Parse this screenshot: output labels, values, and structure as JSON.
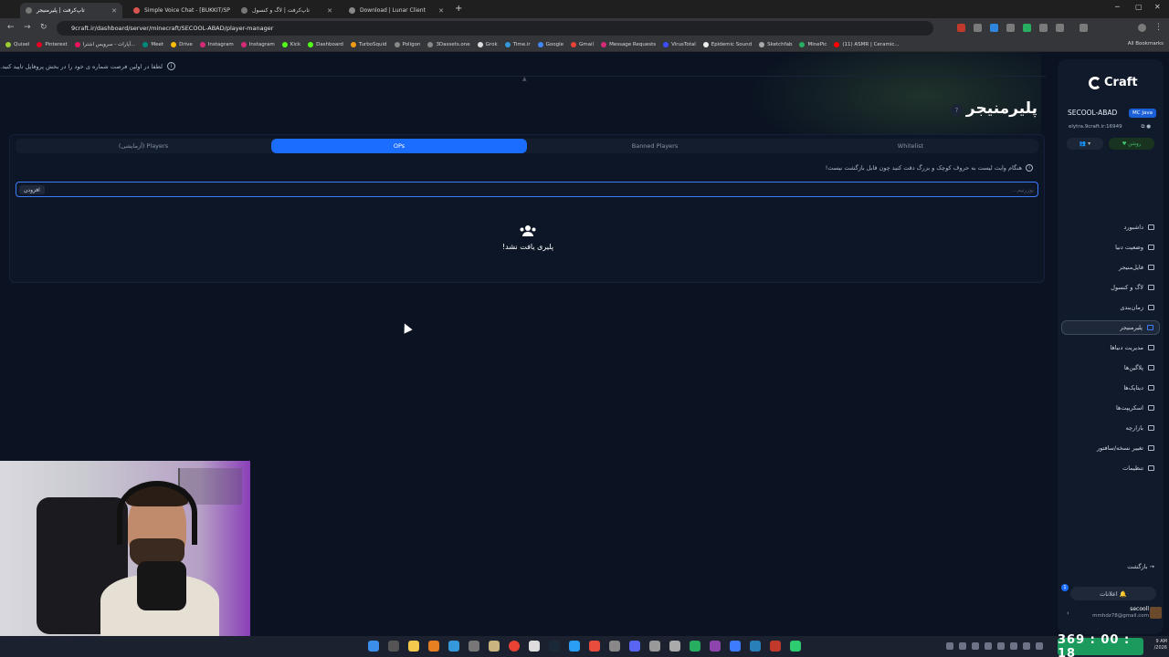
{
  "browser": {
    "tabs": [
      {
        "title": "تاپ‌کرفت | پلیرمنیجر",
        "active": true
      },
      {
        "title": "Simple Voice Chat - [BUKKIT/SP",
        "active": false
      },
      {
        "title": "تاپ‌کرفت | لاگ و کنسول",
        "active": false
      },
      {
        "title": "Download | Lunar Client",
        "active": false
      }
    ],
    "url": "9craft.ir/dashboard/server/minecraft/SECOOL-ABAD/player-manager",
    "bookmarks": [
      "Quixel",
      "Pinterest",
      "آپارات - سرویس اشترا...",
      "Meet",
      "Drive",
      "Instagram",
      "Instagram",
      "Kick",
      "Dashboard",
      "TurboSquid",
      "Poligon",
      "3Dassets.one",
      "Grok",
      "Time.ir",
      "Google",
      "Gmail",
      "Message Requests",
      "VirusTotal",
      "Epidemic Sound",
      "Sketchfab",
      "MinePic",
      "(11) ASMR | Ceramic..."
    ],
    "all_bookmarks": "All Bookmarks"
  },
  "notice": "لطفا در اولین فرصت شماره ی خود را در بخش پروفایل تایید کنید.",
  "page": {
    "title": "پلیرمنیجر",
    "help": "?",
    "tabs": [
      "(آزمایشی) Players",
      "OPs",
      "Banned Players",
      "Whitelist"
    ],
    "active_tab": "OPs",
    "hint": "هنگام وایت لیست به حروف کوچک و بزرگ دقت کنید چون قابل بازگشت نیست!",
    "add_button": "افزودن",
    "username_placeholder": "یوزرنیم...",
    "empty_text": "پلیری یافت نشد!"
  },
  "sidebar": {
    "logo": "Craft",
    "server_name": "SECOOL-ABAD",
    "server_type": "MC Java",
    "server_address": "elytra.9craft.ir:16949",
    "status": "روشن",
    "items": [
      {
        "label": "داشبورد",
        "active": false
      },
      {
        "label": "وضعیت دنیا",
        "active": false
      },
      {
        "label": "فایل‌منیجر",
        "active": false
      },
      {
        "label": "لاگ و کنسول",
        "active": false
      },
      {
        "label": "زمان‌بندی",
        "active": false
      },
      {
        "label": "پلیرمنیجر",
        "active": true
      },
      {
        "label": "مدیریت دنیاها",
        "active": false
      },
      {
        "label": "پلاگین‌ها",
        "active": false
      },
      {
        "label": "دیتاپک‌ها",
        "active": false
      },
      {
        "label": "اسکریپت‌ها",
        "active": false
      },
      {
        "label": "بازارچه",
        "active": false
      },
      {
        "label": "تغییر نسخه/سافتور",
        "active": false
      },
      {
        "label": "تنظیمات",
        "active": false
      }
    ],
    "back": "بازگشت",
    "notifications": "اعلانات",
    "notif_count": "1",
    "user_name": "secooll",
    "user_email": "mmhdz78@gmail.com"
  },
  "taskbar": {
    "timer": "369 : 00 : 18",
    "time": "9 AM",
    "date": "/2026"
  },
  "colors": {
    "accent": "#1a6dff",
    "background": "#0b1322",
    "timer_bg": "#1a9a5c",
    "status_green": "#42c46a"
  }
}
